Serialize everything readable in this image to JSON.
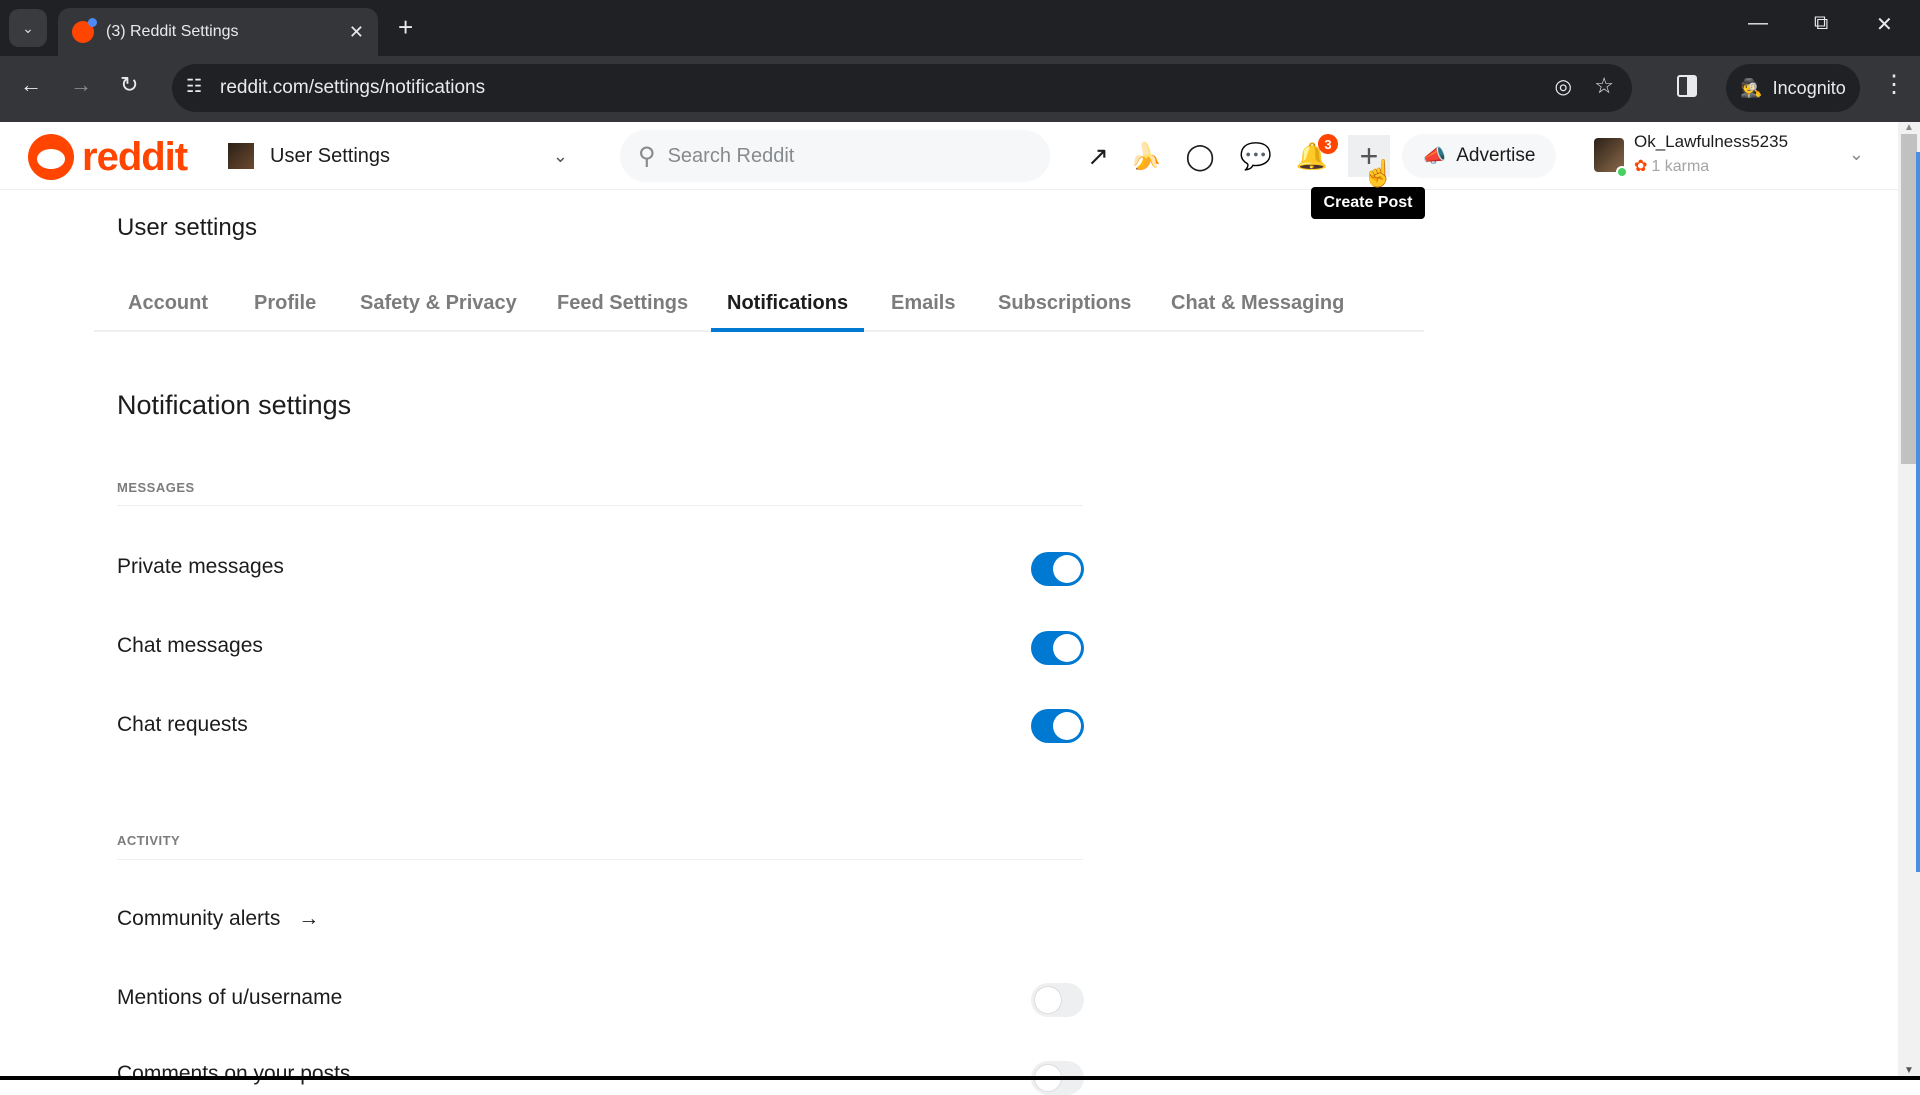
{
  "browser": {
    "tab_title": "(3) Reddit Settings",
    "url": "reddit.com/settings/notifications",
    "incognito_label": "Incognito",
    "icons": {
      "tab_search": "chevron-down-icon",
      "close_tab": "close-icon",
      "new_tab": "plus-icon",
      "minimize": "minimize-icon",
      "restore": "restore-icon",
      "close_window": "close-icon",
      "back": "arrow-left-icon",
      "forward": "arrow-right-icon",
      "reload": "reload-icon",
      "site_info": "tune-icon",
      "eye_off": "eye-off-icon",
      "bookmark": "star-icon",
      "side_panel": "side-panel-icon",
      "menu": "kebab-icon"
    }
  },
  "header": {
    "logo_text": "reddit",
    "community_picker_label": "User Settings",
    "search_placeholder": "Search Reddit",
    "notification_count": "3",
    "advertise_label": "Advertise",
    "create_post_tooltip": "Create Post",
    "user": {
      "name": "Ok_Lawfulness5235",
      "karma": "1 karma",
      "online": true
    },
    "icons": [
      "popular-icon",
      "coins-icon",
      "mod-shield-icon",
      "chat-icon",
      "bell-icon",
      "plus-icon"
    ]
  },
  "page": {
    "title": "User settings",
    "tabs": [
      {
        "label": "Account",
        "active": false
      },
      {
        "label": "Profile",
        "active": false
      },
      {
        "label": "Safety & Privacy",
        "active": false
      },
      {
        "label": "Feed Settings",
        "active": false
      },
      {
        "label": "Notifications",
        "active": true
      },
      {
        "label": "Emails",
        "active": false
      },
      {
        "label": "Subscriptions",
        "active": false
      },
      {
        "label": "Chat & Messaging",
        "active": false
      }
    ],
    "section_title": "Notification settings",
    "groups": [
      {
        "label": "MESSAGES",
        "rows": [
          {
            "label": "Private messages",
            "enabled": true
          },
          {
            "label": "Chat messages",
            "enabled": true
          },
          {
            "label": "Chat requests",
            "enabled": true
          }
        ]
      },
      {
        "label": "ACTIVITY",
        "rows": [
          {
            "label": "Community alerts",
            "link": true
          },
          {
            "label": "Mentions of u/username",
            "enabled": false
          },
          {
            "label": "Comments on your posts",
            "enabled": false
          }
        ]
      }
    ]
  },
  "colors": {
    "brand": "#ff4500",
    "accent": "#0079d3",
    "toggle_off": "#edeff1"
  }
}
